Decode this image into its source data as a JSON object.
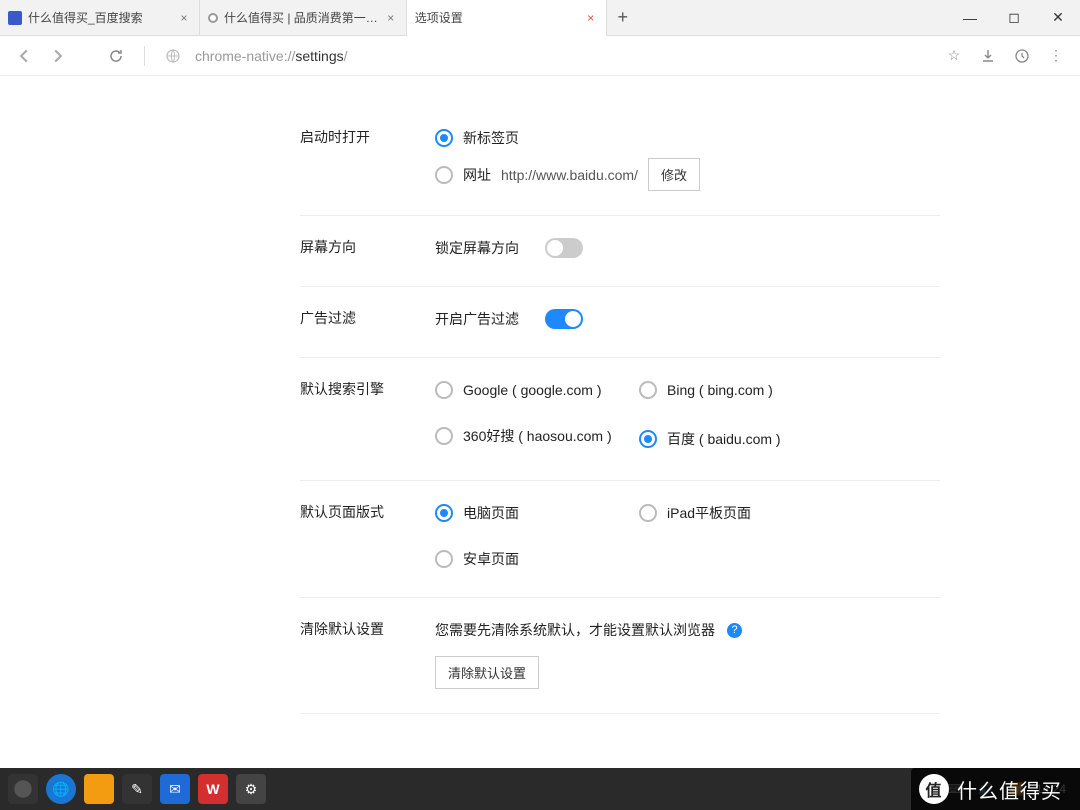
{
  "tabs": {
    "items": [
      {
        "title": "什么值得买_百度搜索",
        "favicon_bg": "#3b5ac8"
      },
      {
        "title": "什么值得买 | 品质消费第一…",
        "favicon_type": "ring"
      },
      {
        "title": "选项设置",
        "favicon_type": "none",
        "active": true
      }
    ]
  },
  "addressbar": {
    "url_prefix": "chrome-native://",
    "url_bold": "settings",
    "url_suffix": "/"
  },
  "settings": {
    "startup": {
      "label": "启动时打开",
      "newtab": "新标签页",
      "url_label": "网址",
      "url_value": "http://www.baidu.com/",
      "modify_btn": "修改",
      "selected": "newtab"
    },
    "orientation": {
      "label": "屏幕方向",
      "lock_text": "锁定屏幕方向",
      "lock_on": false
    },
    "adblock": {
      "label": "广告过滤",
      "enable_text": "开启广告过滤",
      "on": true
    },
    "search": {
      "label": "默认搜索引擎",
      "options": {
        "google": "Google ( google.com )",
        "bing": "Bing ( bing.com )",
        "haosou": "360好搜 ( haosou.com )",
        "baidu": "百度 ( baidu.com )"
      },
      "selected": "baidu"
    },
    "pagestyle": {
      "label": "默认页面版式",
      "options": {
        "desktop": "电脑页面",
        "ipad": "iPad平板页面",
        "android": "安卓页面"
      },
      "selected": "desktop"
    },
    "cleardefault": {
      "label": "清除默认设置",
      "hint": "您需要先清除系统默认，才能设置默认浏览器",
      "btn": "清除默认设置"
    }
  },
  "taskbar": {
    "time": "14:24"
  },
  "watermark": "什么值得买"
}
